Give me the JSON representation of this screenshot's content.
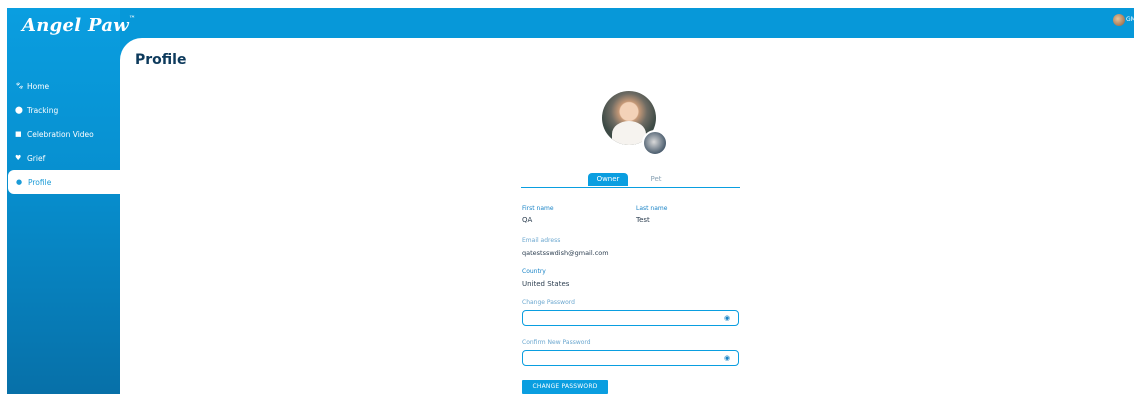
{
  "app": {
    "logo": "Angel Paw",
    "logo_mark": "™",
    "user_initials": "GM"
  },
  "sidebar": {
    "items": [
      {
        "label": "Home",
        "icon": "paw-icon"
      },
      {
        "label": "Tracking",
        "icon": "location-pin-icon"
      },
      {
        "label": "Celebration Video",
        "icon": "video-icon"
      },
      {
        "label": "Grief",
        "icon": "person-heart-icon"
      },
      {
        "label": "Profile",
        "icon": "person-icon",
        "active": true
      }
    ]
  },
  "page": {
    "title": "Profile"
  },
  "tabs": {
    "owner": "Owner",
    "pet": "Pet",
    "active": "Owner"
  },
  "fields": {
    "first_name": {
      "label": "First name",
      "value": "QA"
    },
    "last_name": {
      "label": "Last name",
      "value": "Test"
    },
    "email": {
      "label": "Email adress",
      "value": "qatestsswdish@gmail.com"
    },
    "country": {
      "label": "Country",
      "value": "United States"
    },
    "change_password": {
      "label": "Change Password",
      "value": ""
    },
    "confirm_password": {
      "label": "Confirm New Password",
      "value": ""
    }
  },
  "buttons": {
    "change_password": "CHANGE PASSWORD"
  },
  "colors": {
    "brand": "#0798d9",
    "title": "#0d3a5c",
    "label": "#1a84c7"
  }
}
